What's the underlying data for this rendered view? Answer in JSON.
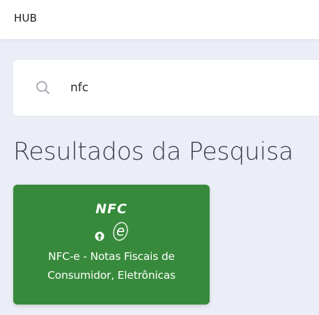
{
  "header": {
    "brand": "HUB"
  },
  "search": {
    "value": "nfc",
    "icon": "search-icon"
  },
  "results": {
    "heading": "Resultados da Pesquisa",
    "items": [
      {
        "logo_text": "NFC",
        "logo_icon": "nfce-logo-icon",
        "title": "NFC-e - Notas Fiscais de Consumidor, Eletrônicas",
        "background": "#378a3b"
      }
    ]
  },
  "colors": {
    "page_background": "#eceef7",
    "card_green": "#378a3b",
    "heading_text": "#3a3f4d"
  }
}
